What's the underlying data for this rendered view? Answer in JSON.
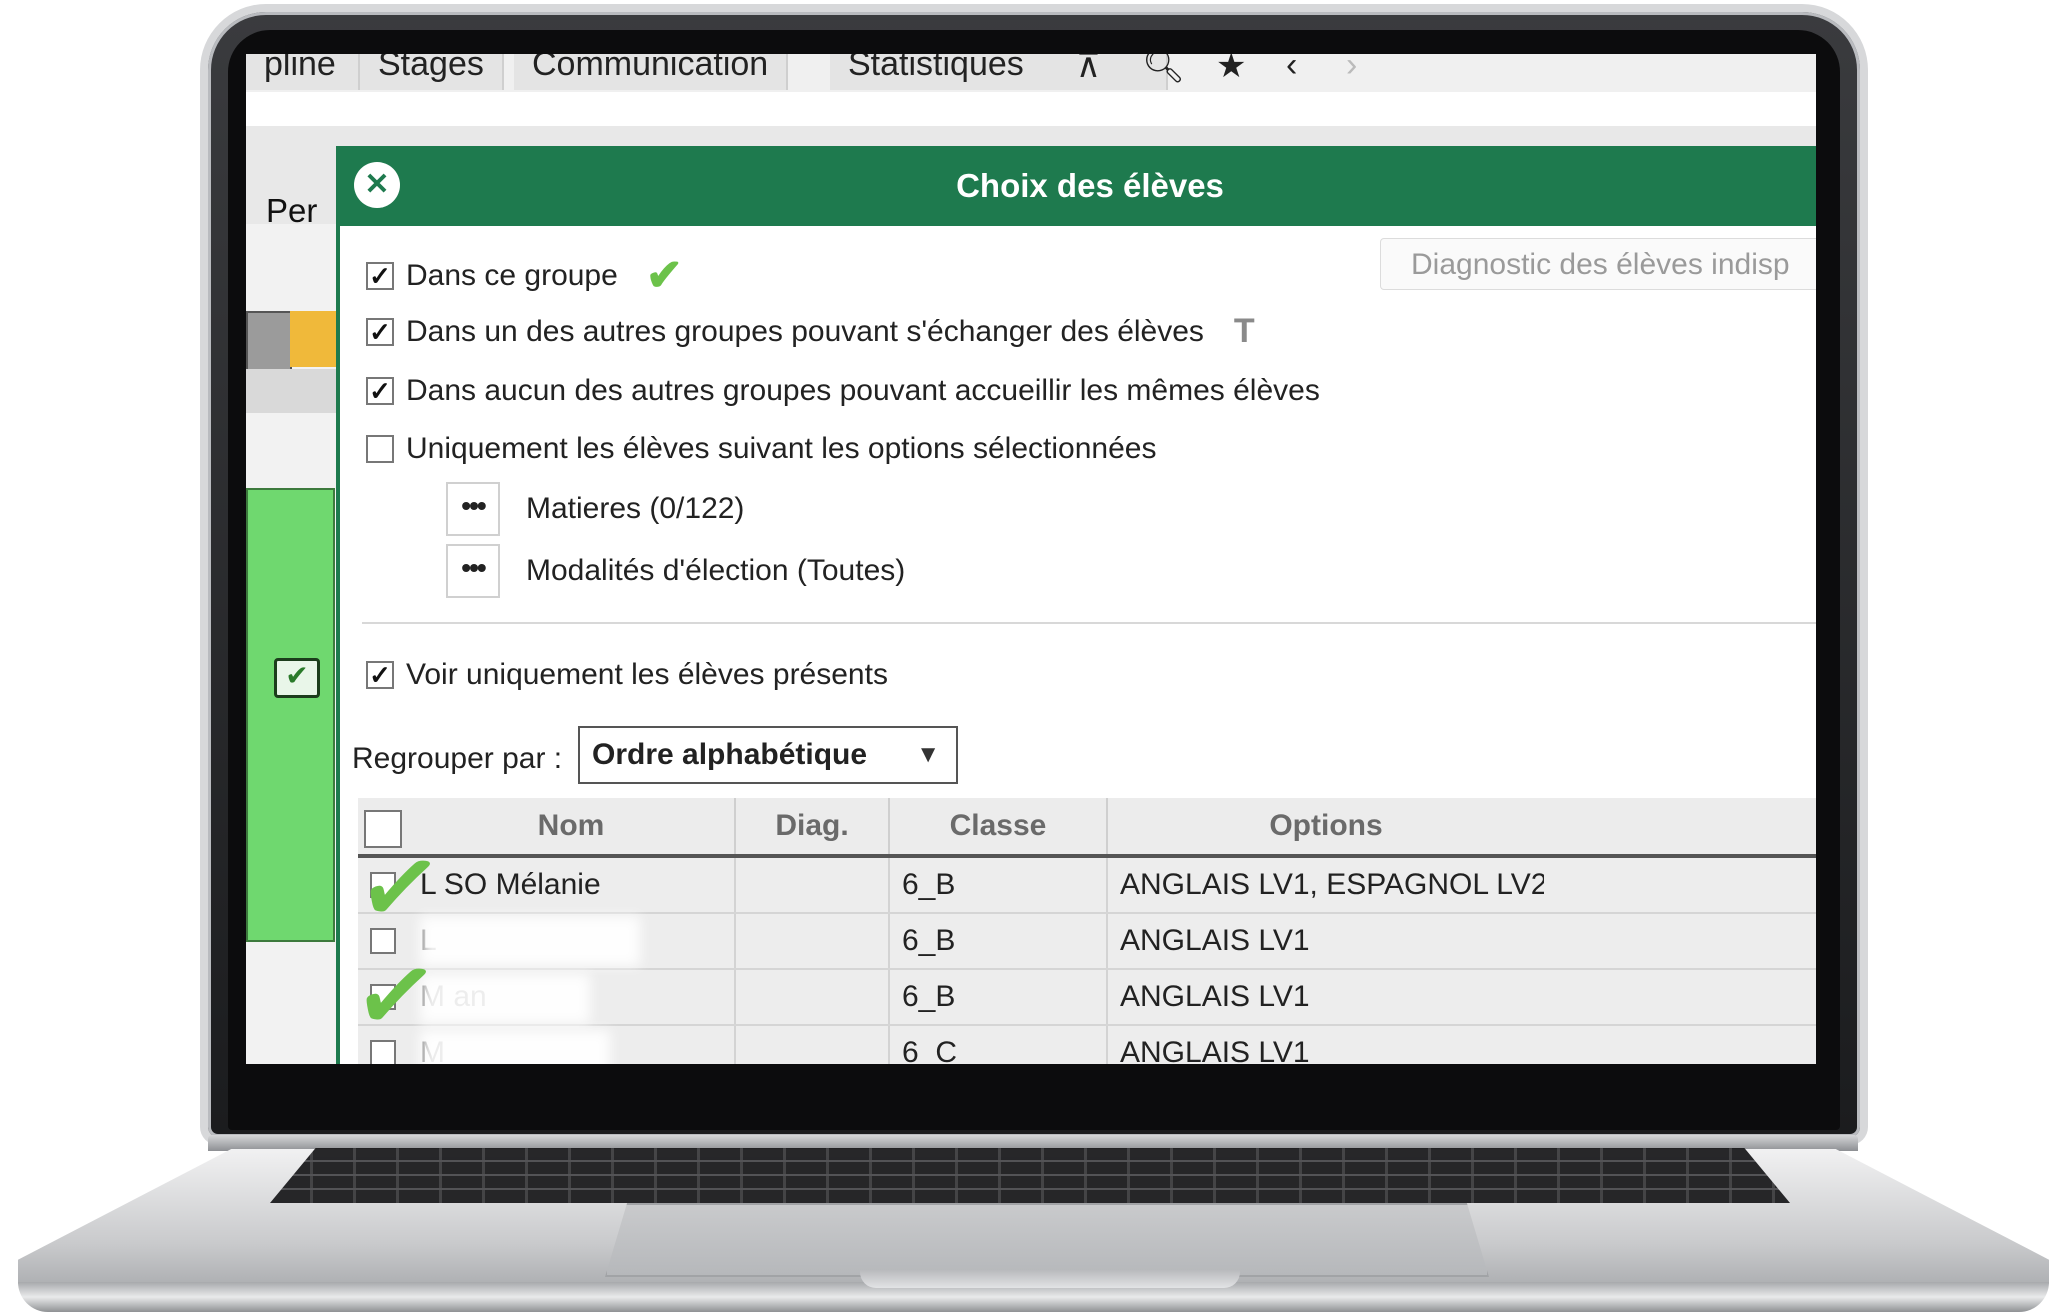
{
  "menubar": {
    "tabs": [
      "pline",
      "Stages",
      "Communication",
      "Statistiques"
    ],
    "tool_icons": [
      "pin-icon",
      "search-icon",
      "bookmark-icon",
      "back-icon",
      "forward-icon"
    ]
  },
  "toolbar": {
    "partial_label": "Per"
  },
  "dialog": {
    "title": "Choix des élèves",
    "options": [
      {
        "label": "Dans ce groupe",
        "checked": true
      },
      {
        "label": "Dans un des autres groupes pouvant s'échanger des élèves",
        "checked": true
      },
      {
        "label": "Dans aucun des autres groupes pouvant accueillir les mêmes élèves",
        "checked": true
      },
      {
        "label": "Uniquement les élèves suivant les options sélectionnées",
        "checked": false
      }
    ],
    "diag_button": "Diagnostic des élèves indisp",
    "sub_options": [
      {
        "button": "•••",
        "label": "Matieres (0/122)"
      },
      {
        "button": "•••",
        "label": "Modalités d'élection (Toutes)"
      }
    ],
    "present_only": {
      "label": "Voir uniquement les élèves présents",
      "checked": true
    },
    "group_by": {
      "label": "Regrouper par :",
      "value": "Ordre alphabétique"
    },
    "table": {
      "columns": [
        "Nom",
        "Diag.",
        "Classe",
        "Options"
      ],
      "rows": [
        {
          "nom": "L                SO Mélanie",
          "diag": "",
          "classe": "6_B",
          "options": "ANGLAIS LV1, ESPAGNOL LV2"
        },
        {
          "nom": "L",
          "diag": "",
          "classe": "6_B",
          "options": "ANGLAIS LV1"
        },
        {
          "nom": "M                  an",
          "diag": "",
          "classe": "6_B",
          "options": "ANGLAIS LV1"
        },
        {
          "nom": "M",
          "diag": "",
          "classe": "6_C",
          "options": "ANGLAIS LV1"
        }
      ]
    }
  },
  "colors": {
    "accent": "#1e7a4e",
    "check": "#6cc24a",
    "sidebar_green": "#6fd86f"
  }
}
